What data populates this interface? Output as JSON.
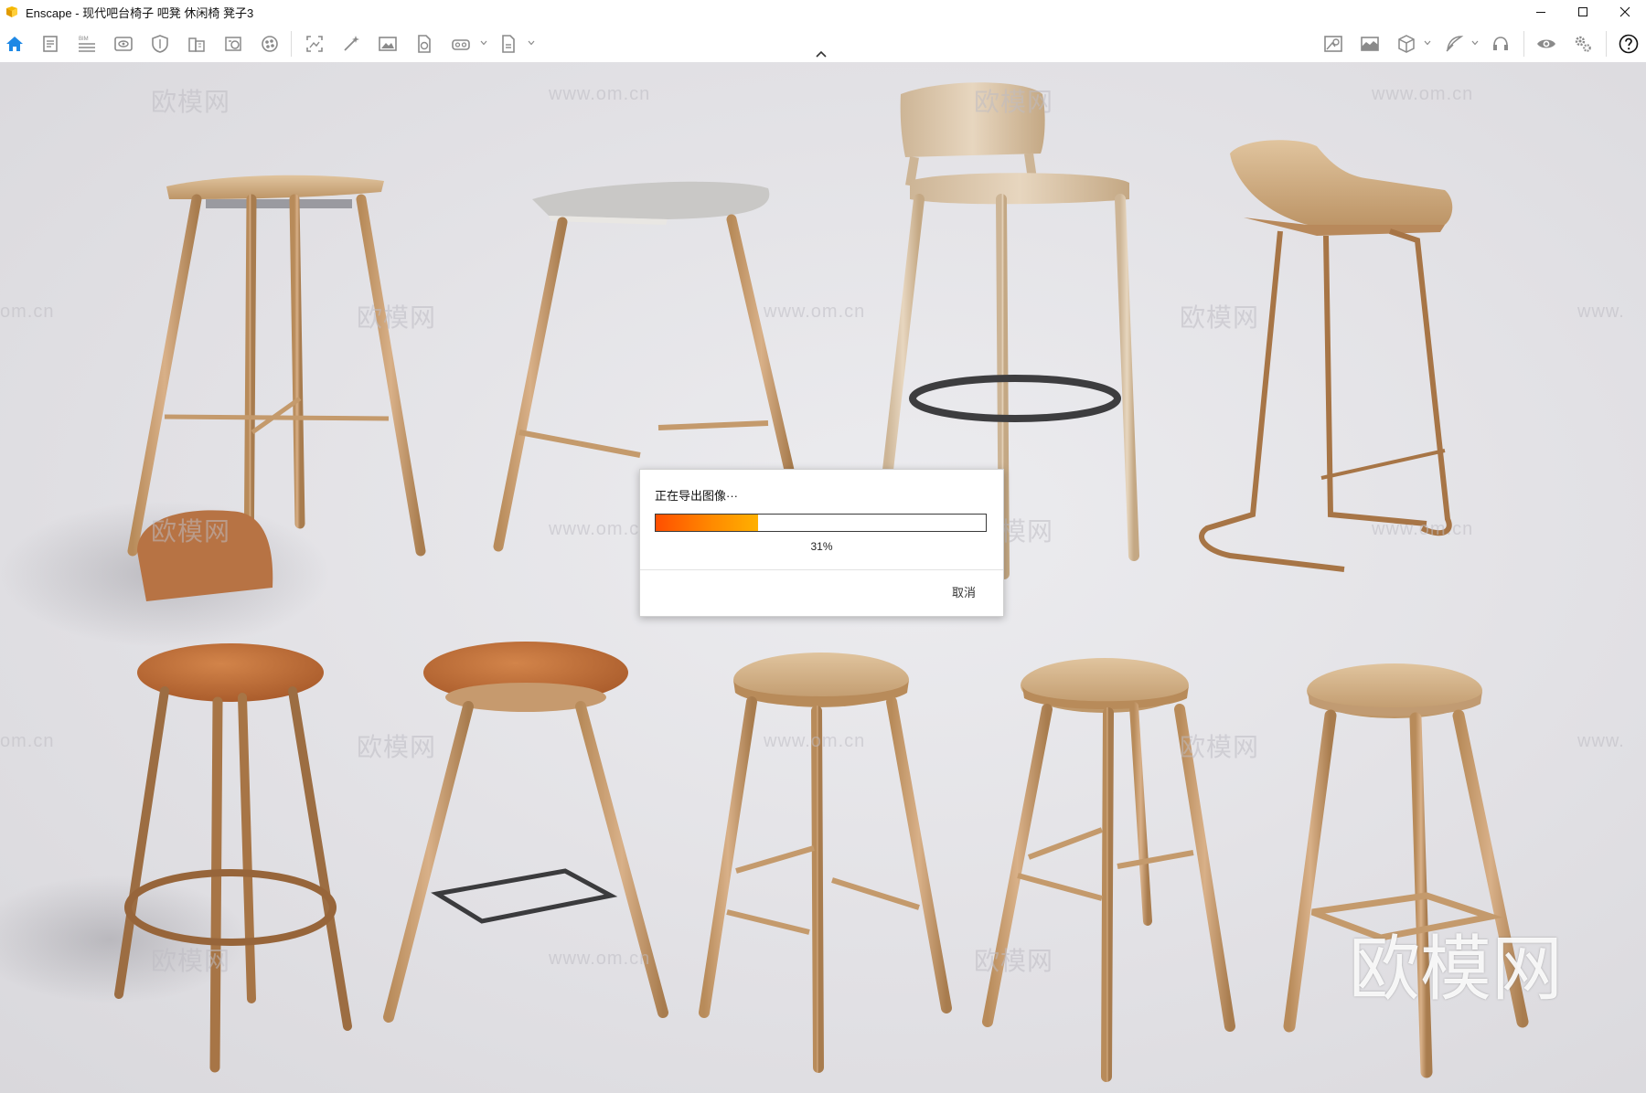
{
  "window": {
    "app_name": "Enscape",
    "title": "Enscape - 现代吧台椅子 吧凳 休闲椅 凳子3",
    "accent": "#f5b800",
    "controls": [
      {
        "name": "minimize-icon"
      },
      {
        "name": "maximize-icon"
      },
      {
        "name": "close-icon"
      }
    ]
  },
  "toolbar": {
    "left_tools": [
      {
        "icon": "home-icon",
        "active": true
      },
      {
        "icon": "document-icon"
      },
      {
        "icon": "bim-icon",
        "label": "BIM"
      },
      {
        "icon": "view-icon"
      },
      {
        "icon": "shield-icon"
      },
      {
        "icon": "building-icon"
      },
      {
        "icon": "asset-library-icon"
      },
      {
        "icon": "material-icon"
      },
      {
        "icon": "screenshot-icon"
      },
      {
        "icon": "magic-wand-icon"
      },
      {
        "icon": "image-icon"
      },
      {
        "icon": "export-file-icon"
      },
      {
        "icon": "vr-headset-icon"
      },
      {
        "icon": "pdf-export-icon"
      }
    ],
    "right_tools": [
      {
        "icon": "visual-settings-icon"
      },
      {
        "icon": "panorama-icon"
      },
      {
        "icon": "cube-view-icon"
      },
      {
        "icon": "feather-icon"
      },
      {
        "icon": "headset-icon"
      },
      {
        "icon": "eye-icon"
      },
      {
        "icon": "settings-gears-icon"
      },
      {
        "icon": "help-icon"
      }
    ],
    "colors": {
      "active": "#1e88e5",
      "icon": "#8a8a8a"
    }
  },
  "viewport": {
    "watermarks": [
      "欧模网",
      "www.om.cn",
      "om.cn",
      "www."
    ],
    "brand_watermark": "欧模网"
  },
  "dialog": {
    "title": "正在导出图像···",
    "progress_percent": 31,
    "progress_text": "31%",
    "cancel_label": "取消"
  }
}
